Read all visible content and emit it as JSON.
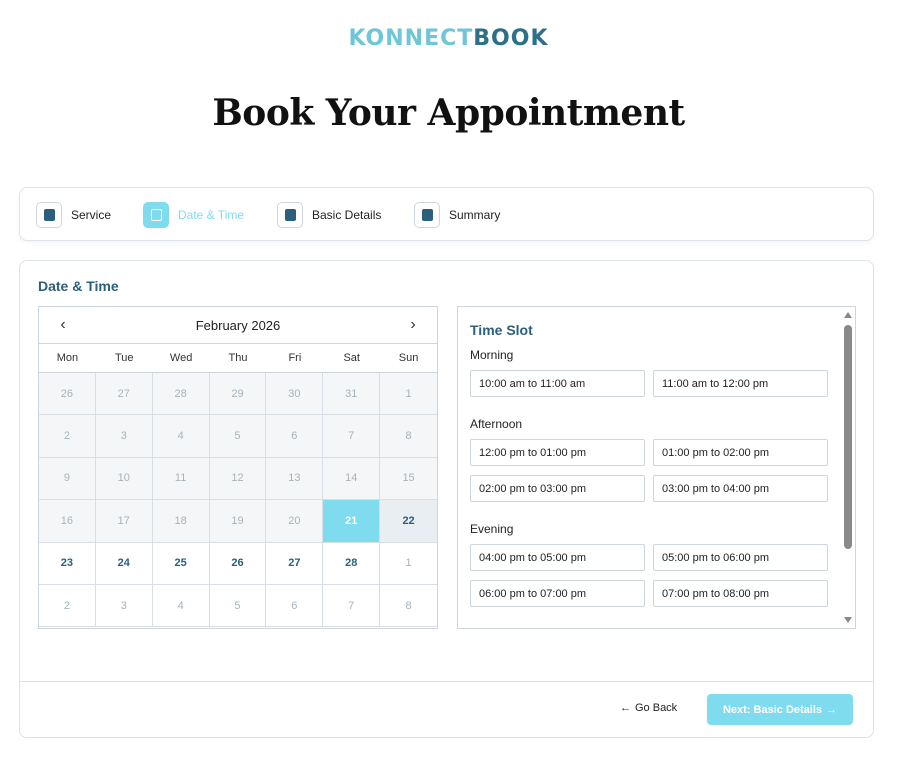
{
  "brand": {
    "part1": "KONNECT",
    "part2": "BOOK"
  },
  "page_title": "Book Your Appointment",
  "steps": [
    {
      "label": "Service",
      "icon": "service-icon",
      "active": false
    },
    {
      "label": "Date & Time",
      "icon": "calendar-icon",
      "active": true
    },
    {
      "label": "Basic Details",
      "icon": "document-icon",
      "active": false
    },
    {
      "label": "Summary",
      "icon": "checklist-icon",
      "active": false
    }
  ],
  "section_title": "Date & Time",
  "calendar": {
    "month_label": "February 2026",
    "prev_icon": "chevron-left-icon",
    "next_icon": "chevron-right-icon",
    "weekdays": [
      "Mon",
      "Tue",
      "Wed",
      "Thu",
      "Fri",
      "Sat",
      "Sun"
    ],
    "days": [
      {
        "d": "26",
        "s": "disabled"
      },
      {
        "d": "27",
        "s": "disabled"
      },
      {
        "d": "28",
        "s": "disabled"
      },
      {
        "d": "29",
        "s": "disabled"
      },
      {
        "d": "30",
        "s": "disabled"
      },
      {
        "d": "31",
        "s": "disabled"
      },
      {
        "d": "1",
        "s": "disabled"
      },
      {
        "d": "2",
        "s": "disabled"
      },
      {
        "d": "3",
        "s": "disabled"
      },
      {
        "d": "4",
        "s": "disabled"
      },
      {
        "d": "5",
        "s": "disabled"
      },
      {
        "d": "6",
        "s": "disabled"
      },
      {
        "d": "7",
        "s": "disabled"
      },
      {
        "d": "8",
        "s": "disabled"
      },
      {
        "d": "9",
        "s": "disabled"
      },
      {
        "d": "10",
        "s": "disabled"
      },
      {
        "d": "11",
        "s": "disabled"
      },
      {
        "d": "12",
        "s": "disabled"
      },
      {
        "d": "13",
        "s": "disabled"
      },
      {
        "d": "14",
        "s": "disabled"
      },
      {
        "d": "15",
        "s": "disabled"
      },
      {
        "d": "16",
        "s": "disabled"
      },
      {
        "d": "17",
        "s": "disabled"
      },
      {
        "d": "18",
        "s": "disabled"
      },
      {
        "d": "19",
        "s": "disabled"
      },
      {
        "d": "20",
        "s": "disabled"
      },
      {
        "d": "21",
        "s": "selected"
      },
      {
        "d": "22",
        "s": "today"
      },
      {
        "d": "23",
        "s": "available"
      },
      {
        "d": "24",
        "s": "available"
      },
      {
        "d": "25",
        "s": "available"
      },
      {
        "d": "26",
        "s": "available"
      },
      {
        "d": "27",
        "s": "available"
      },
      {
        "d": "28",
        "s": "available"
      },
      {
        "d": "1",
        "s": "other"
      },
      {
        "d": "2",
        "s": "other"
      },
      {
        "d": "3",
        "s": "other"
      },
      {
        "d": "4",
        "s": "other"
      },
      {
        "d": "5",
        "s": "other"
      },
      {
        "d": "6",
        "s": "other"
      },
      {
        "d": "7",
        "s": "other"
      },
      {
        "d": "8",
        "s": "other"
      }
    ]
  },
  "time_slots": {
    "title": "Time Slot",
    "groups": [
      {
        "label": "Morning",
        "slots": [
          "10:00 am to 11:00 am",
          "11:00 am to 12:00 pm"
        ]
      },
      {
        "label": "Afternoon",
        "slots": [
          "12:00 pm to 01:00 pm",
          "01:00 pm to 02:00 pm",
          "02:00 pm to 03:00 pm",
          "03:00 pm to 04:00 pm"
        ]
      },
      {
        "label": "Evening",
        "slots": [
          "04:00 pm to 05:00 pm",
          "05:00 pm to 06:00 pm",
          "06:00 pm to 07:00 pm",
          "07:00 pm to 08:00 pm"
        ]
      }
    ]
  },
  "footer": {
    "back_label": "Go Back",
    "back_icon": "arrow-left-icon",
    "next_label": "Next: Basic Details",
    "next_icon": "arrow-right-icon"
  },
  "colors": {
    "accent": "#7fdcef",
    "primary": "#2c5f7c"
  }
}
